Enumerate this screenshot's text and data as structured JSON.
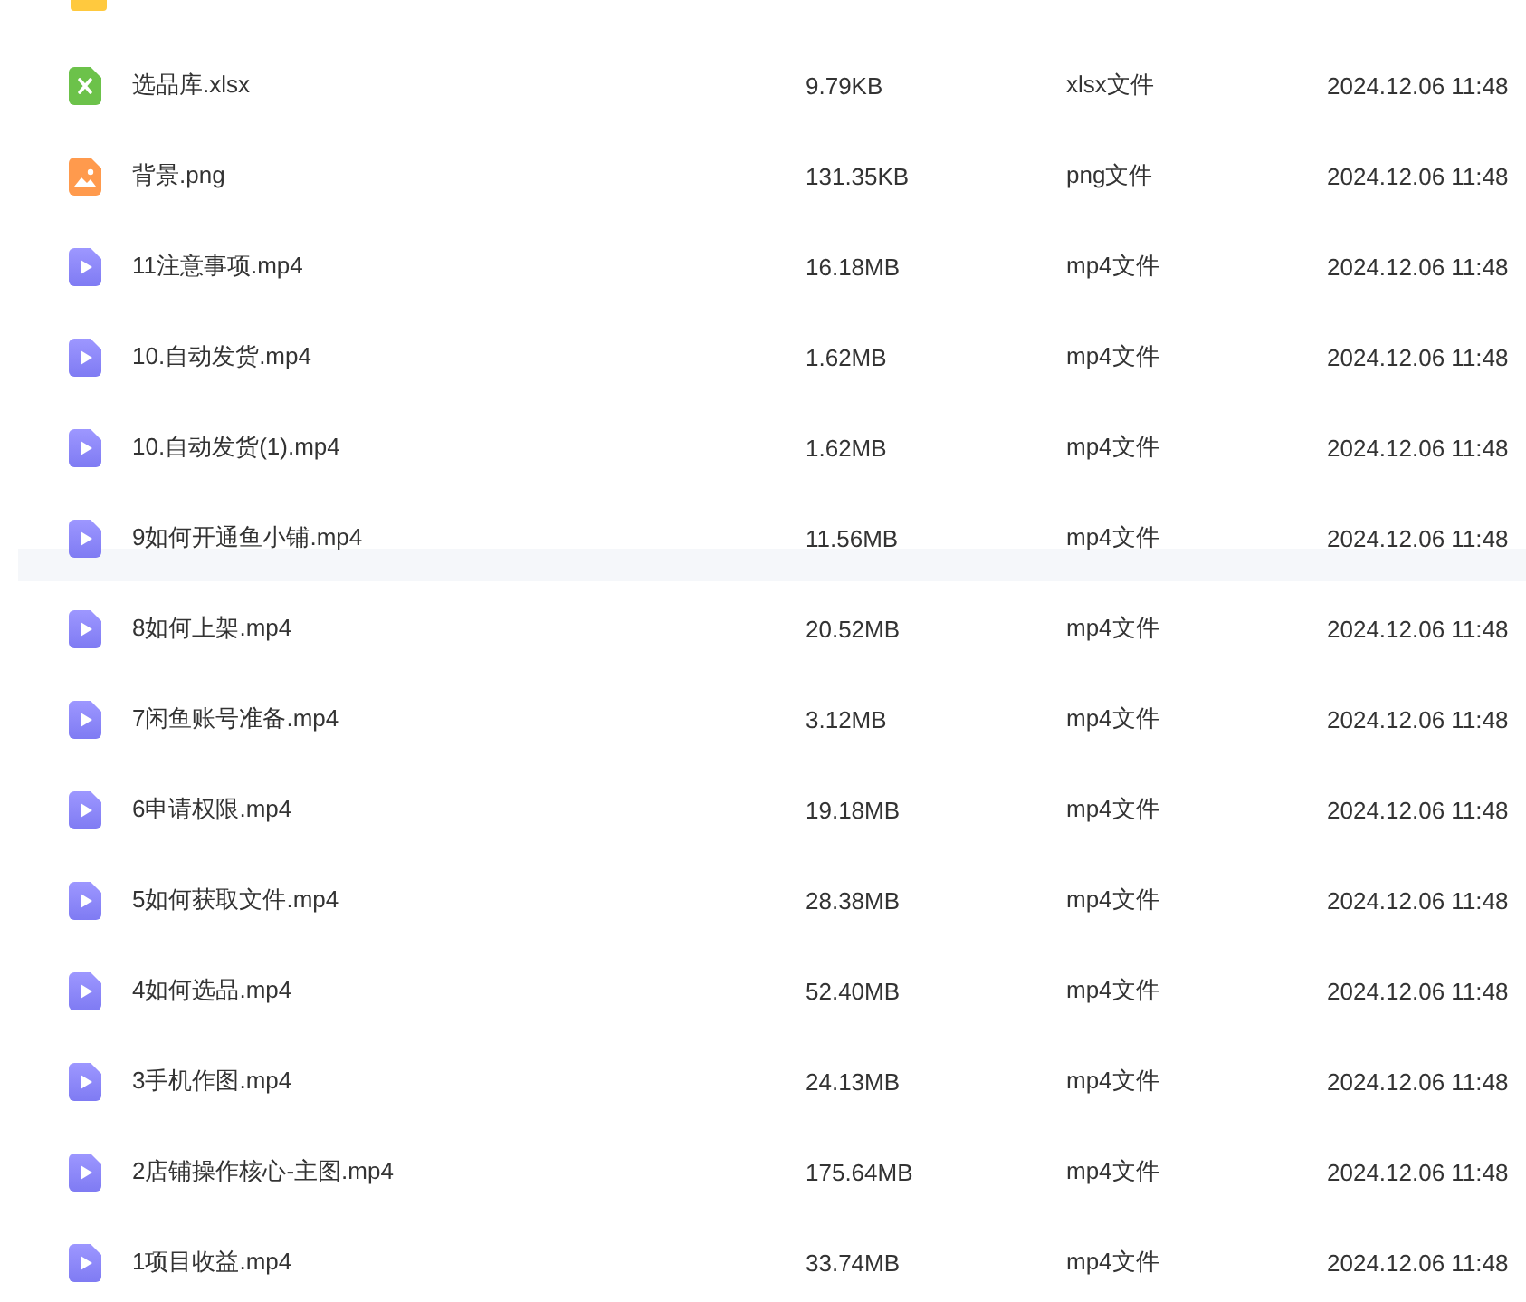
{
  "files": [
    {
      "kind": "folder"
    },
    {
      "kind": "xlsx",
      "name": "选品库.xlsx",
      "size": "9.79KB",
      "type": "xlsx文件",
      "date": "2024.12.06 11:48",
      "hovered": false
    },
    {
      "kind": "image",
      "name": "背景.png",
      "size": "131.35KB",
      "type": "png文件",
      "date": "2024.12.06 11:48",
      "hovered": false
    },
    {
      "kind": "video",
      "name": "11注意事项.mp4",
      "size": "16.18MB",
      "type": "mp4文件",
      "date": "2024.12.06 11:48",
      "hovered": false
    },
    {
      "kind": "video",
      "name": "10.自动发货.mp4",
      "size": "1.62MB",
      "type": "mp4文件",
      "date": "2024.12.06 11:48",
      "hovered": false
    },
    {
      "kind": "video",
      "name": "10.自动发货(1).mp4",
      "size": "1.62MB",
      "type": "mp4文件",
      "date": "2024.12.06 11:48",
      "hovered": false
    },
    {
      "kind": "video",
      "name": "9如何开通鱼小铺.mp4",
      "size": "11.56MB",
      "type": "mp4文件",
      "date": "2024.12.06 11:48",
      "hovered": true
    },
    {
      "kind": "video",
      "name": "8如何上架.mp4",
      "size": "20.52MB",
      "type": "mp4文件",
      "date": "2024.12.06 11:48",
      "hovered": false
    },
    {
      "kind": "video",
      "name": "7闲鱼账号准备.mp4",
      "size": "3.12MB",
      "type": "mp4文件",
      "date": "2024.12.06 11:48",
      "hovered": false
    },
    {
      "kind": "video",
      "name": "6申请权限.mp4",
      "size": "19.18MB",
      "type": "mp4文件",
      "date": "2024.12.06 11:48",
      "hovered": false
    },
    {
      "kind": "video",
      "name": "5如何获取文件.mp4",
      "size": "28.38MB",
      "type": "mp4文件",
      "date": "2024.12.06 11:48",
      "hovered": false
    },
    {
      "kind": "video",
      "name": "4如何选品.mp4",
      "size": "52.40MB",
      "type": "mp4文件",
      "date": "2024.12.06 11:48",
      "hovered": false
    },
    {
      "kind": "video",
      "name": "3手机作图.mp4",
      "size": "24.13MB",
      "type": "mp4文件",
      "date": "2024.12.06 11:48",
      "hovered": false
    },
    {
      "kind": "video",
      "name": "2店铺操作核心-主图.mp4",
      "size": "175.64MB",
      "type": "mp4文件",
      "date": "2024.12.06 11:48",
      "hovered": false
    },
    {
      "kind": "video",
      "name": "1项目收益.mp4",
      "size": "33.74MB",
      "type": "mp4文件",
      "date": "2024.12.06 11:48",
      "hovered": false
    }
  ]
}
